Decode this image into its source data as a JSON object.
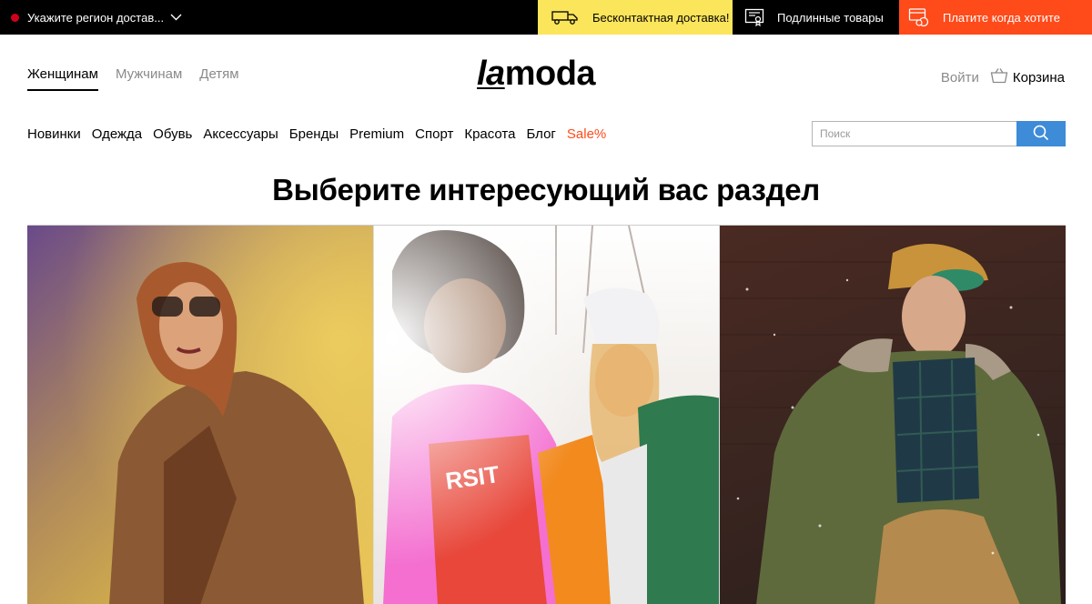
{
  "topbar": {
    "region_label": "Укажите регион достав...",
    "delivery_promo": "Бесконтактная доставка!",
    "original_promo": "Подлинные товары",
    "pay_promo": "Платите когда хотите"
  },
  "header": {
    "gender_tabs": [
      {
        "label": "Женщинам",
        "active": true
      },
      {
        "label": "Мужчинам",
        "active": false
      },
      {
        "label": "Детям",
        "active": false
      }
    ],
    "logo": {
      "part1": "la",
      "part2": "moda"
    },
    "login_label": "Войти",
    "cart_label": "Корзина"
  },
  "categories": [
    "Новинки",
    "Одежда",
    "Обувь",
    "Аксессуары",
    "Бренды",
    "Premium",
    "Спорт",
    "Красота",
    "Блог",
    "Sale%"
  ],
  "search": {
    "placeholder": "Поиск"
  },
  "headline": "Выберите интересующий вас раздел",
  "colors": {
    "sale": "#ff4a1a",
    "delivery_bg": "#fbe55b",
    "pay_bg": "#ff4a1a",
    "search_button": "#3e8bd8"
  },
  "icons": {
    "region": "red-dot-icon",
    "delivery": "truck-icon",
    "original": "certificate-icon",
    "pay": "card-coins-icon",
    "cart": "basket-icon",
    "search": "search-icon"
  }
}
